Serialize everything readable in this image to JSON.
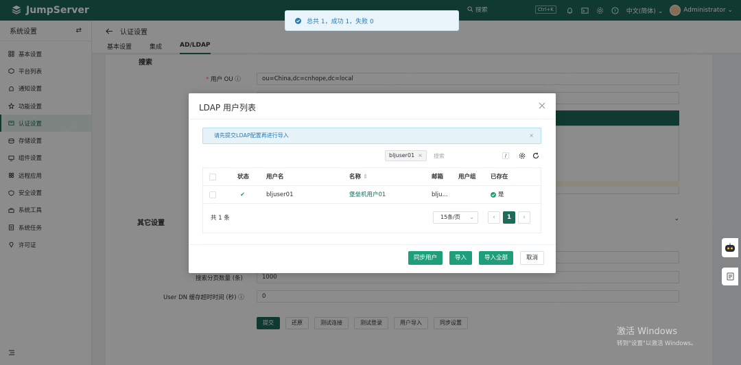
{
  "topbar": {
    "brand": "JumpServer",
    "search_placeholder": "搜索",
    "search_shortcut": "Ctrl+K",
    "language": "中文(简体)",
    "user": "Administrator",
    "colors": {
      "bar": "#1e6b5a",
      "accent": "#1e9e7a"
    }
  },
  "sidebar": {
    "title": "系统设置",
    "items": [
      {
        "label": "基本设置",
        "icon": "grid-icon"
      },
      {
        "label": "平台列表",
        "icon": "cube-icon"
      },
      {
        "label": "通知设置",
        "icon": "bell-icon"
      },
      {
        "label": "功能设置",
        "icon": "star-icon"
      },
      {
        "label": "认证设置",
        "icon": "id-card-icon",
        "active": true
      },
      {
        "label": "存储设置",
        "icon": "storage-icon"
      },
      {
        "label": "组件设置",
        "icon": "monitor-icon"
      },
      {
        "label": "远程应用",
        "icon": "apps-icon"
      },
      {
        "label": "安全设置",
        "icon": "shield-icon"
      },
      {
        "label": "系统工具",
        "icon": "toolbox-icon"
      },
      {
        "label": "系统任务",
        "icon": "task-icon"
      },
      {
        "label": "许可证",
        "icon": "diamond-icon"
      }
    ]
  },
  "header": {
    "title": "认证设置",
    "tabs": [
      {
        "label": "基本设置"
      },
      {
        "label": "集成"
      },
      {
        "label": "AD/LDAP",
        "active": true
      }
    ]
  },
  "form": {
    "search_section": "搜索",
    "user_ou_label": "用户 OU",
    "user_ou_value": "ou=China,dc=cnhope,dc=local",
    "other_section": "其它设置",
    "page_size_label": "搜索分页数量 (条)",
    "page_size_value": "1000",
    "cache_timeout_label": "User DN 缓存超时时间 (秒)",
    "cache_timeout_value": "0",
    "buttons": {
      "submit": "提交",
      "reset": "还原",
      "test_connection": "测试连接",
      "test_login": "测试登录",
      "user_import": "用户导入",
      "sync_settings": "同步设置"
    }
  },
  "dialog": {
    "title": "LDAP 用户列表",
    "alert": "请先提交LDAP配置再进行导入",
    "filter_tag": "bljuser01",
    "search_placeholder": "搜索",
    "search_shortcut": "/",
    "table": {
      "headers": {
        "status": "状态",
        "username": "用户名",
        "name": "名称",
        "email": "邮箱",
        "groups": "用户组",
        "existing": "已存在"
      },
      "rows": [
        {
          "status": "✔",
          "username": "bljuser01",
          "name": "堡垒机用户01",
          "email": "blju...",
          "groups": "",
          "existing": "是"
        }
      ]
    },
    "pagination": {
      "total": "共 1 条",
      "page_size": "15条/页",
      "current_page": "1"
    },
    "buttons": {
      "sync": "同步用户",
      "import": "导入",
      "import_all": "导入全部",
      "cancel": "取消"
    }
  },
  "toast": {
    "message": "总共 1，成功 1，失败 0"
  },
  "windows_activation": {
    "title": "激活 Windows",
    "subtitle": "转到\"设置\"以激活 Windows。"
  }
}
